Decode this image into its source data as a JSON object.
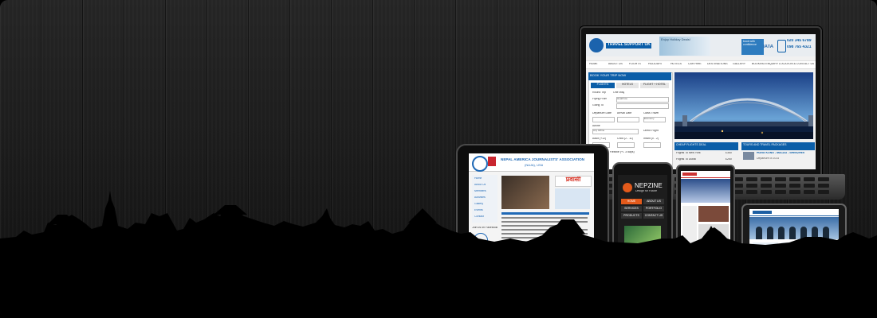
{
  "laptop_site": {
    "brand": "TRAVEL SUPPORT UK",
    "banner_text": "Enjoy Holiday Deals!",
    "accredit_text": "book with\nconfidence",
    "iata": "IATA",
    "phone_1": "020 345 6789",
    "phone_2": "098 765 4321",
    "nav": [
      "HOME",
      "ABOUT US",
      "FLIGHTS",
      "HOLIDAYS",
      "HOTELS",
      "CAR HIRE",
      "DESTINATIONS",
      "GALLERY",
      "BOOKING ENQUIRY",
      "LOCATION & CONTACT US"
    ],
    "booking_title": "BOOK YOUR TRIP NOW",
    "booking_tabs": [
      "FLIGHTS",
      "HOTELS",
      "FLIGHT + HOTEL"
    ],
    "trip_options": [
      "Round Trip",
      "One Way"
    ],
    "flying_from_label": "Flying From",
    "flying_from_value": "Heathrow",
    "going_to_label": "Going To",
    "departure_label": "Departure Date",
    "arrival_label": "Arrival Date",
    "class_label": "Class Travel",
    "class_value": "Economy",
    "airline_label": "Airline",
    "airline_value": "Any Airline",
    "direct_label": "Direct Flight",
    "adult_label": "Adult (+12)",
    "child_label": "Child (2 - 11)",
    "infant_label": "Infant (0 - 2)",
    "flexible_text": "My Dates are Flexible (+/- 3 days)",
    "cheap_title": "CHEAP FLIGHTS DEAL",
    "deals": [
      {
        "route": "Flights To New York",
        "price": "£350"
      },
      {
        "route": "Flights To Dubai",
        "price": "£250"
      }
    ],
    "tours_title": "TOURS AND TRAVEL PACKAGES",
    "tour_name": "HONG KONG - MACAU - SHENZHEN",
    "tour_sub": "Departure of 2014"
  },
  "tablet_site": {
    "title": "NEPAL AMERICA JOURNALISTS' ASSOCIATION",
    "subtitle": "(NAJA), USA",
    "menu": [
      "Home",
      "About Us",
      "Members",
      "Activities",
      "Gallery",
      "Events",
      "Contact"
    ],
    "newspaper": "प्रवासी",
    "side_label": "Join us on Facebook"
  },
  "phone_site": {
    "brand": "NEPZINE",
    "tagline": "Design for Future",
    "menu": [
      "HOME",
      "ABOUT US",
      "SERVICES",
      "PORTFOLIO",
      "PRODUCTS",
      "CONTACT US"
    ]
  },
  "colors": {
    "background": "#1c1c1c",
    "travel_blue": "#0b5ea8",
    "nepzine_orange": "#e35a1b",
    "naja_blue": "#1f69b6"
  }
}
